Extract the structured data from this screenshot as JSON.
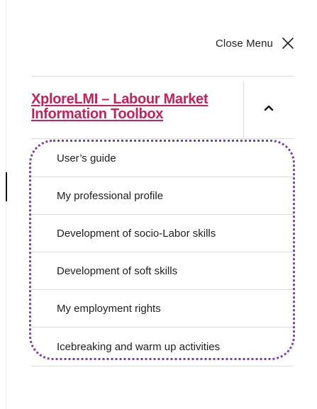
{
  "menu": {
    "close_label": "Close Menu",
    "section": {
      "title": "XploreLMI – Labour Market Information Toolbox",
      "expanded": true
    },
    "items": [
      {
        "label": "User’s guide"
      },
      {
        "label": "My professional profile"
      },
      {
        "label": "Development of socio-Labor skills"
      },
      {
        "label": "Development of soft skills"
      },
      {
        "label": "My employment rights"
      },
      {
        "label": "Icebreaking and warm up activities"
      }
    ]
  },
  "colors": {
    "accent_title": "#c8205a",
    "focus_outline": "#7b3fb0",
    "divider": "#dcdcdc"
  },
  "icons": {
    "close": "close-icon",
    "collapse": "chevron-up-icon"
  }
}
